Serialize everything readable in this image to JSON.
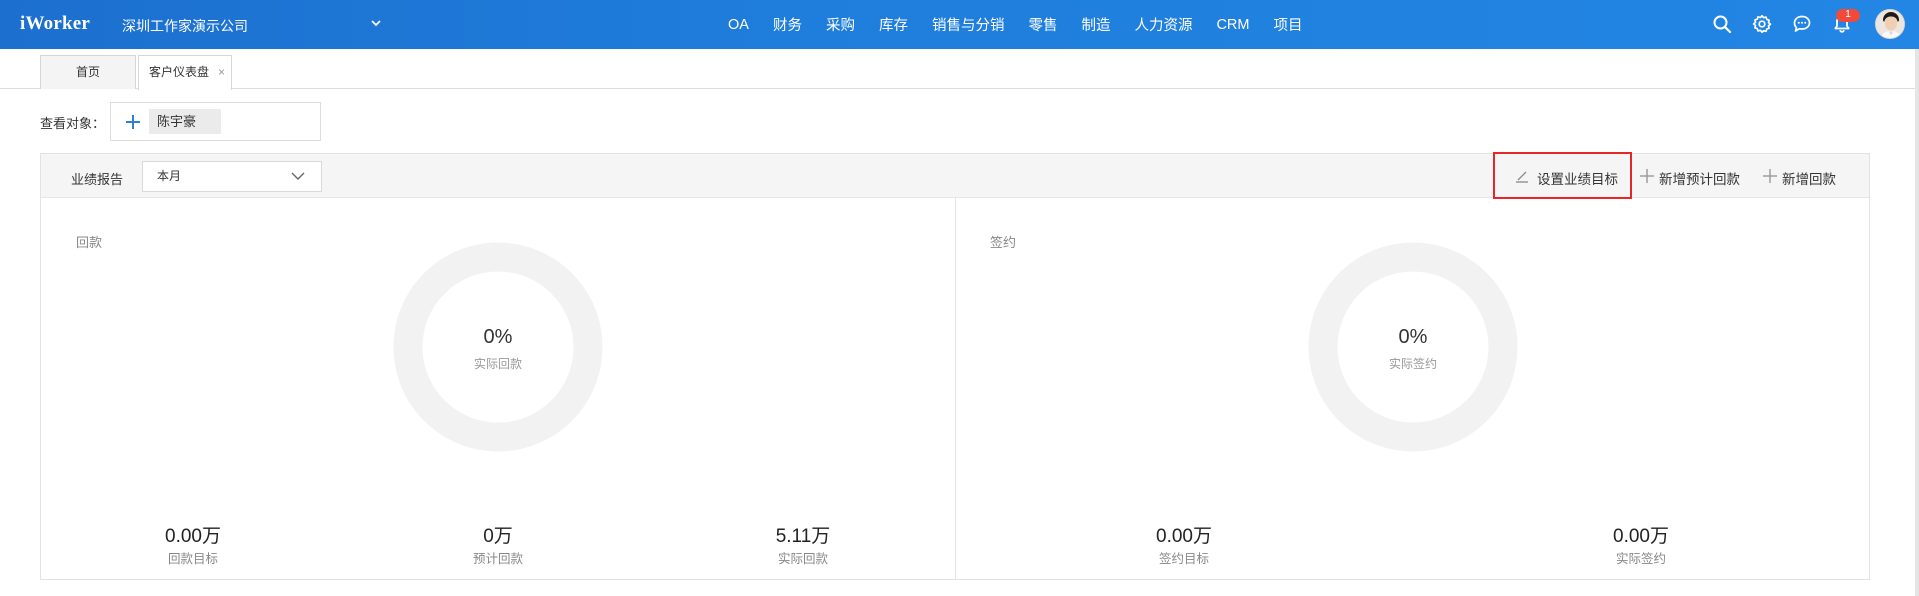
{
  "header": {
    "logo": "iWorker",
    "company": "深圳工作家演示公司",
    "nav": [
      "OA",
      "财务",
      "采购",
      "库存",
      "销售与分销",
      "零售",
      "制造",
      "人力资源",
      "CRM",
      "项目"
    ],
    "notification_count": "1",
    "icons": [
      "search-icon",
      "gear-icon",
      "chat-icon",
      "bell-icon"
    ]
  },
  "tabs": {
    "home": "首页",
    "customer_dashboard": "客户仪表盘",
    "close": "×"
  },
  "viewer": {
    "label": "查看对象：",
    "person": "陈宇豪"
  },
  "report": {
    "label": "业绩报告",
    "period": "本月",
    "actions": {
      "set_target": "设置业绩目标",
      "add_expected_payment": "新增预计回款",
      "add_payment": "新增回款"
    }
  },
  "payment": {
    "title": "回款",
    "percent": "0%",
    "center_label": "实际回款",
    "stats": [
      {
        "value": "0.00万",
        "label": "回款目标"
      },
      {
        "value": "0万",
        "label": "预计回款"
      },
      {
        "value": "5.11万",
        "label": "实际回款"
      }
    ]
  },
  "contract": {
    "title": "签约",
    "percent": "0%",
    "center_label": "实际签约",
    "stats": [
      {
        "value": "0.00万",
        "label": "签约目标"
      },
      {
        "value": "0.00万",
        "label": "实际签约"
      }
    ]
  },
  "colors": {
    "header_blue": "#1f7ddb",
    "highlight_red": "#e8262a",
    "donut_ring": "#f2f2f2",
    "badge_red": "#f04b3a"
  }
}
